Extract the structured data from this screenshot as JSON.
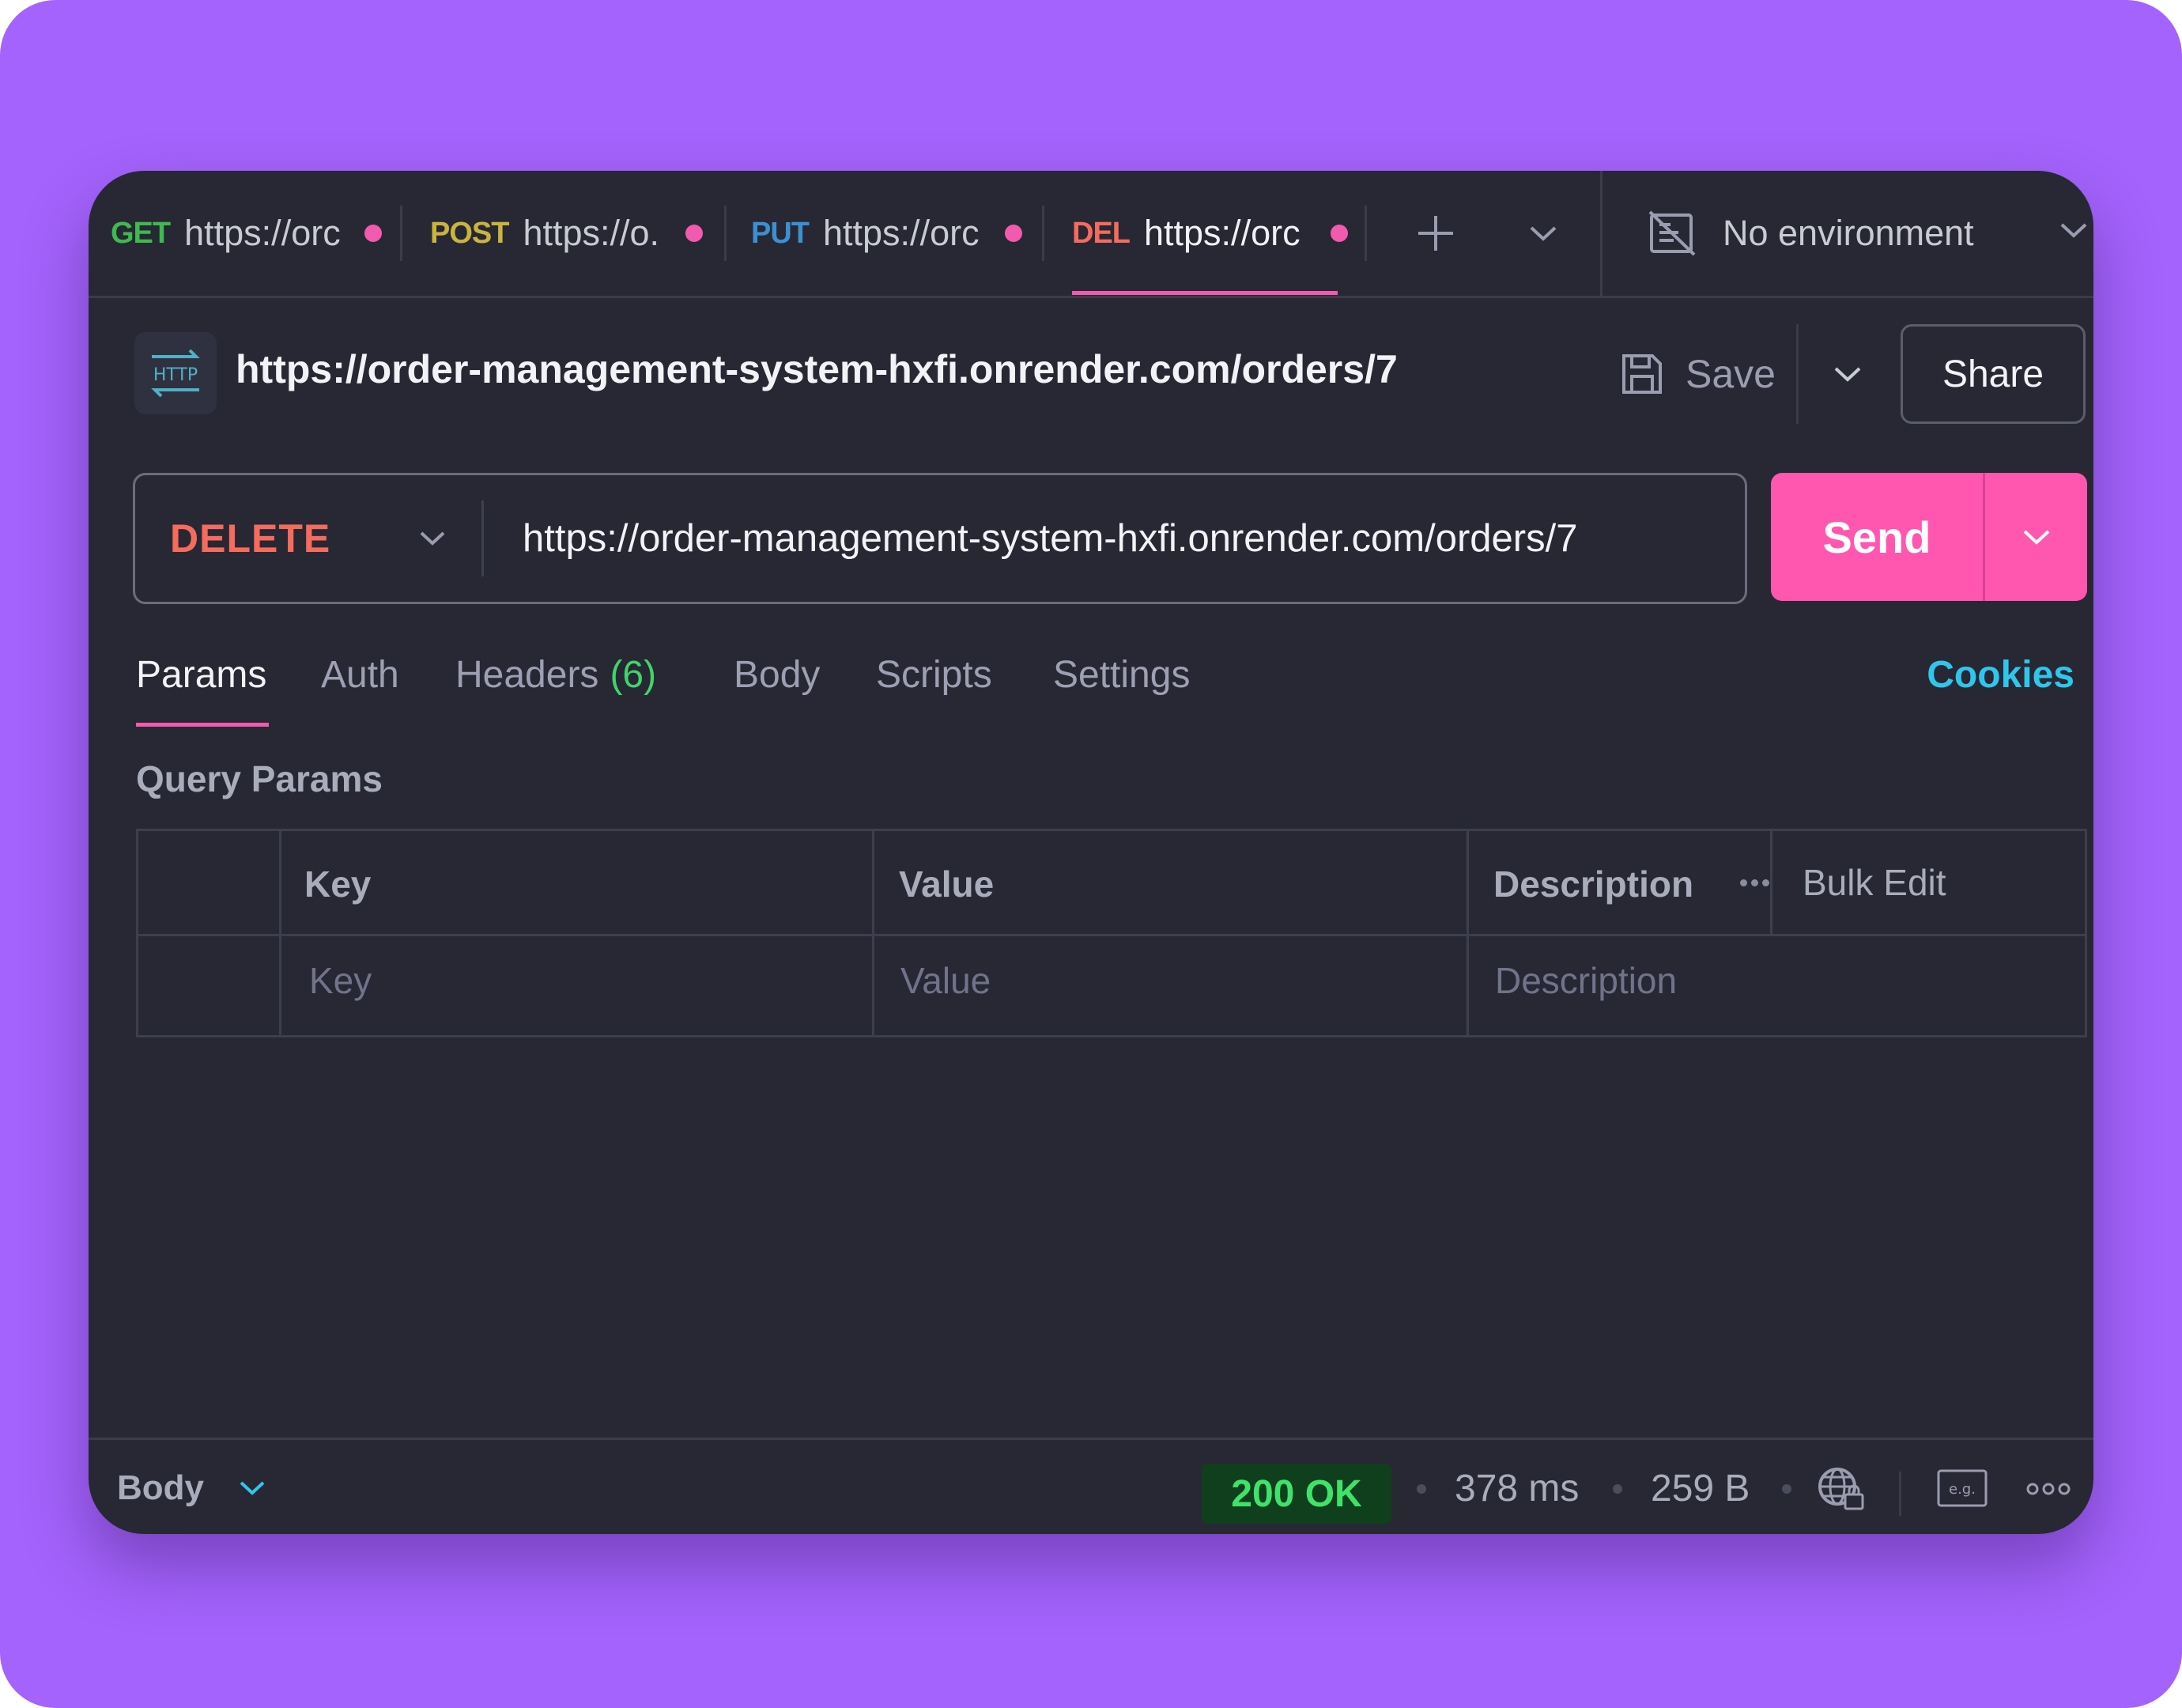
{
  "tabs": [
    {
      "method": "GET",
      "url": "https://orc",
      "color": "#3fb950"
    },
    {
      "method": "POST",
      "url": "https://o.",
      "color": "#c9b43f"
    },
    {
      "method": "PUT",
      "url": "https://orc",
      "color": "#3d8fd1"
    },
    {
      "method": "DEL",
      "url": "https://orc",
      "color": "#f56b5e"
    }
  ],
  "environment": {
    "label": "No environment"
  },
  "request": {
    "title": "https://order-management-system-hxfi.onrender.com/orders/7",
    "method": "DELETE",
    "url": "https://order-management-system-hxfi.onrender.com/orders/7",
    "badge_text": "HTTP"
  },
  "header_actions": {
    "save_label": "Save",
    "share_label": "Share",
    "send_label": "Send"
  },
  "subtabs": {
    "params": "Params",
    "auth": "Auth",
    "headers": "Headers",
    "headers_count": "(6)",
    "body": "Body",
    "scripts": "Scripts",
    "settings": "Settings",
    "cookies": "Cookies"
  },
  "query_params": {
    "title": "Query Params",
    "columns": {
      "key": "Key",
      "value": "Value",
      "description": "Description"
    },
    "bulk_edit": "Bulk Edit",
    "placeholders": {
      "key": "Key",
      "value": "Value",
      "description": "Description"
    }
  },
  "response": {
    "body_label": "Body",
    "status": "200 OK",
    "time": "378 ms",
    "size": "259 B",
    "example_label": "e.g."
  },
  "colors": {
    "background": "#a463fc",
    "panel": "#272833",
    "accent": "#ff57b0",
    "status_ok": "#3fe36a",
    "cookies_link": "#2fc6ee",
    "method_delete": "#f56b5e"
  }
}
